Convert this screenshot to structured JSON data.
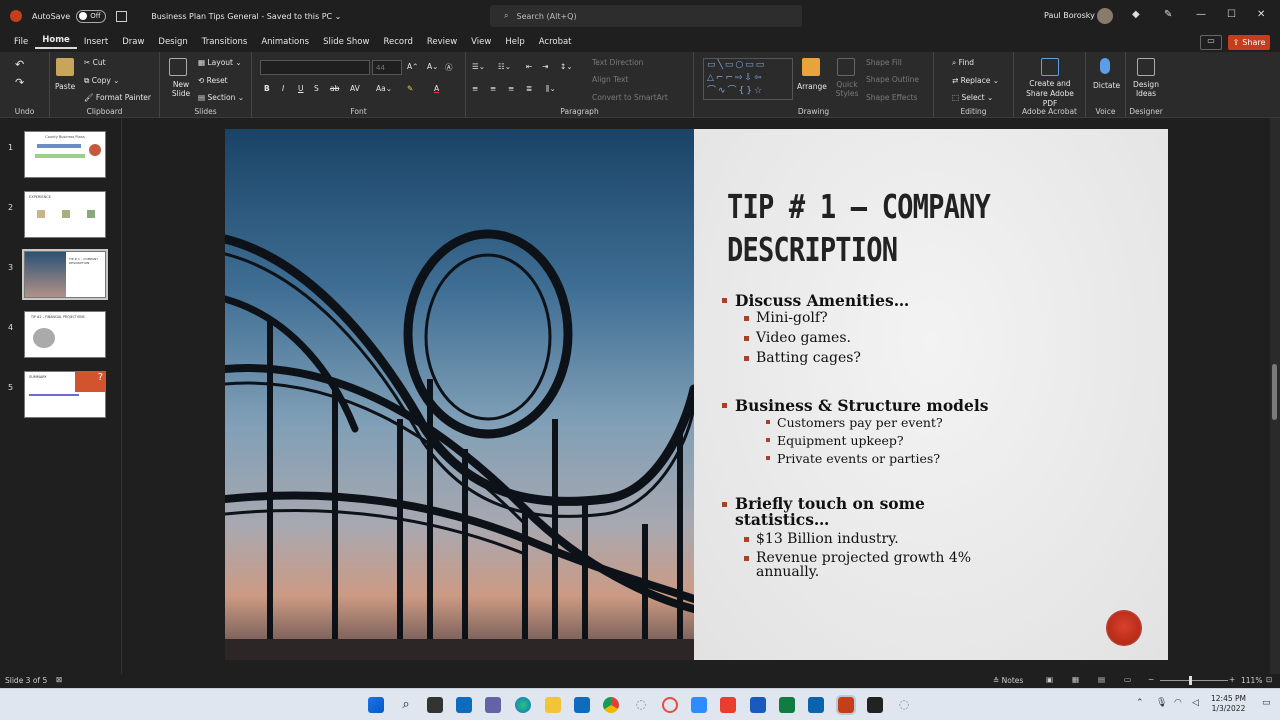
{
  "titlebar": {
    "autosave_label": "AutoSave",
    "autosave_state": "Off",
    "doc_title": "Business Plan Tips General  -  Saved to this PC  ⌄",
    "search_placeholder": "Search (Alt+Q)",
    "user_name": "Paul Borosky",
    "window_controls": [
      "—",
      "☐",
      "✕"
    ]
  },
  "menu": {
    "tabs": [
      "File",
      "Home",
      "Insert",
      "Draw",
      "Design",
      "Transitions",
      "Animations",
      "Slide Show",
      "Record",
      "Review",
      "View",
      "Help",
      "Acrobat"
    ],
    "active": "Home",
    "share_label": "Share"
  },
  "ribbon": {
    "undo_label": "Undo",
    "clipboard": {
      "paste": "Paste",
      "cut": "Cut",
      "copy": "Copy",
      "format_painter": "Format Painter",
      "label": "Clipboard"
    },
    "slides": {
      "new_slide": "New Slide",
      "layout": "Layout",
      "reset": "Reset",
      "section": "Section",
      "label": "Slides"
    },
    "font": {
      "size": "44",
      "label": "Font"
    },
    "paragraph": {
      "text_direction": "Text Direction",
      "align_text": "Align Text",
      "convert_smartart": "Convert to SmartArt",
      "label": "Paragraph"
    },
    "drawing": {
      "arrange": "Arrange",
      "quick_styles": "Quick Styles",
      "shape_fill": "Shape Fill",
      "shape_outline": "Shape Outline",
      "shape_effects": "Shape Effects",
      "label": "Drawing"
    },
    "editing": {
      "find": "Find",
      "replace": "Replace",
      "select": "Select",
      "label": "Editing"
    },
    "acrobat": {
      "create_share": "Create and Share Adobe PDF",
      "label": "Adobe Acrobat"
    },
    "voice": {
      "dictate": "Dictate",
      "label": "Voice"
    },
    "designer": {
      "design_ideas": "Design Ideas",
      "label": "Designer"
    }
  },
  "thumbnails": [
    {
      "num": "1",
      "title": "County Business Plans"
    },
    {
      "num": "2",
      "title": "EXPERIENCE"
    },
    {
      "num": "3",
      "title": "TIP # 1 – COMPANY DESCRIPTION"
    },
    {
      "num": "4",
      "title": "TIP #2 – FINANCIAL PROJECTIONS"
    },
    {
      "num": "5",
      "title": "SUMMARY"
    }
  ],
  "selected_slide": 3,
  "slide": {
    "title_line1": "TIP # 1 – COMPANY",
    "title_line2": "DESCRIPTION",
    "b1": "Discuss Amenities…",
    "b1_items": [
      "Mini-golf?",
      "Video games.",
      "Batting cages?"
    ],
    "b2": "Business & Structure models",
    "b2_items": [
      "Customers pay per event?",
      "Equipment upkeep?",
      "Private events or parties?"
    ],
    "b3_line1": "Briefly touch on some",
    "b3_line2": "statistics…",
    "b3_items": [
      "$13 Billion industry."
    ],
    "b3_item2_line1": "Revenue projected growth 4%",
    "b3_item2_line2": "annually.",
    "accent_color": "#a8412a"
  },
  "status": {
    "slide_of": "Slide 3 of 5",
    "notes": "Notes",
    "zoom": "111%"
  },
  "clock": {
    "time": "12:45 PM",
    "date": "1/3/2022"
  }
}
